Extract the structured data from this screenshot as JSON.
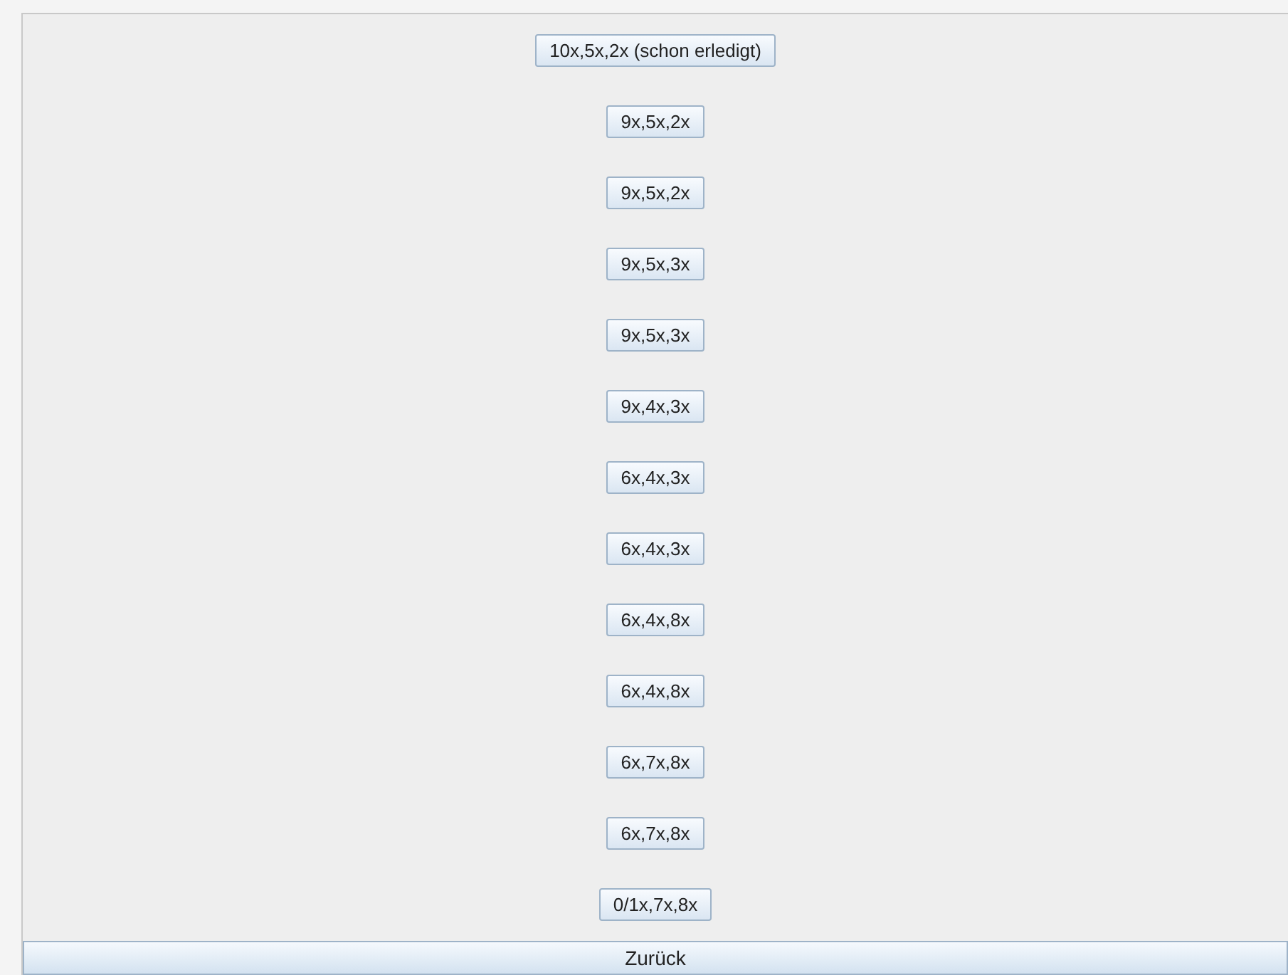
{
  "buttons": [
    {
      "label": "10x,5x,2x (schon erledigt)"
    },
    {
      "label": "9x,5x,2x"
    },
    {
      "label": "9x,5x,2x"
    },
    {
      "label": "9x,5x,3x"
    },
    {
      "label": "9x,5x,3x"
    },
    {
      "label": "9x,4x,3x"
    },
    {
      "label": "6x,4x,3x"
    },
    {
      "label": "6x,4x,3x"
    },
    {
      "label": "6x,4x,8x"
    },
    {
      "label": "6x,4x,8x"
    },
    {
      "label": "6x,7x,8x"
    },
    {
      "label": "6x,7x,8x"
    },
    {
      "label": "0/1x,7x,8x"
    }
  ],
  "back_button": {
    "label": "Zurück"
  }
}
